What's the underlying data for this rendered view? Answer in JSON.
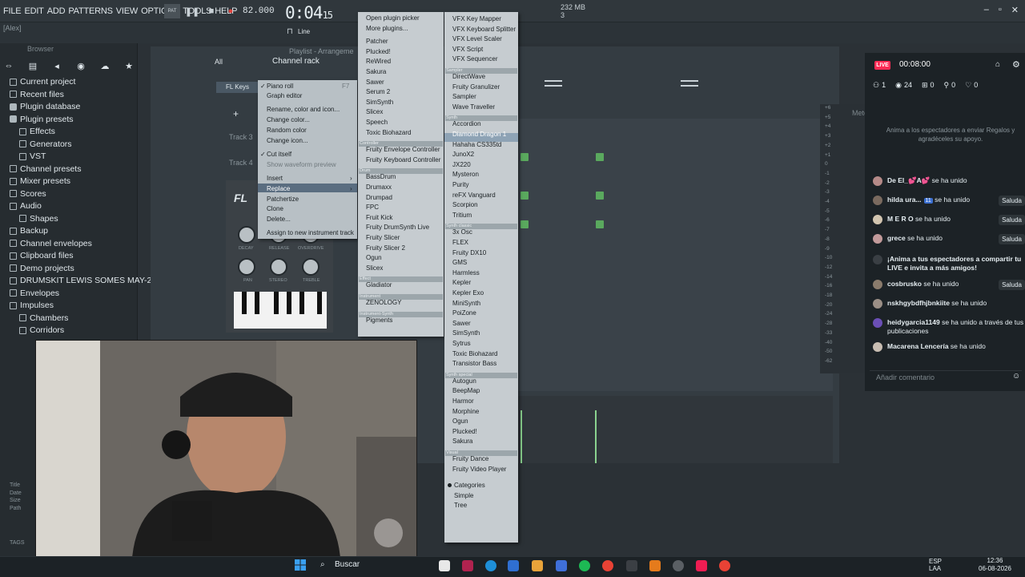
{
  "menubar": {
    "items": [
      "FILE",
      "EDIT",
      "ADD",
      "PATTERNS",
      "VIEW",
      "OPTIONS",
      "TOOLS",
      "HELP"
    ],
    "tempo": "82.000",
    "time_main": "0:04",
    "time_sub": "15",
    "memory": "232 MB",
    "memory_sub": "3"
  },
  "hint": "[Alex]",
  "toolbar": {
    "snap": "Line"
  },
  "browser": {
    "title": "Browser",
    "items": [
      {
        "label": "Current project",
        "icon": "folder"
      },
      {
        "label": "Recent files",
        "icon": "folder"
      },
      {
        "label": "Plugin database",
        "icon": "plugin"
      },
      {
        "label": "Plugin presets",
        "icon": "plugin"
      },
      {
        "label": "Effects",
        "icon": "folder"
      },
      {
        "label": "Generators",
        "icon": "folder"
      },
      {
        "label": "VST",
        "icon": "folder"
      },
      {
        "label": "Channel presets",
        "icon": "folder"
      },
      {
        "label": "Mixer presets",
        "icon": "folder"
      },
      {
        "label": "Scores",
        "icon": "folder"
      },
      {
        "label": "Audio",
        "icon": "folder"
      },
      {
        "label": "Shapes",
        "icon": "folder"
      },
      {
        "label": "Backup",
        "icon": "folder"
      },
      {
        "label": "Channel envelopes",
        "icon": "folder"
      },
      {
        "label": "Clipboard files",
        "icon": "folder"
      },
      {
        "label": "Demo projects",
        "icon": "folder"
      },
      {
        "label": "DRUMSKIT LEWIS SOMES MAY-2026",
        "icon": "folder"
      },
      {
        "label": "Envelopes",
        "icon": "folder"
      },
      {
        "label": "Impulses",
        "icon": "folder"
      },
      {
        "label": "Chambers",
        "icon": "folder"
      },
      {
        "label": "Corridors",
        "icon": "folder"
      }
    ],
    "file_info": [
      "Title",
      "Date",
      "Size",
      "Path"
    ],
    "tags": "TAGS"
  },
  "channel_rack": {
    "title": "Channel rack",
    "filter": "All",
    "playlist_tab": "Playlist - Arrangeme",
    "channel": "FL Keys",
    "tracks": [
      "Track 3",
      "Track 4"
    ],
    "knobs": [
      "DECAY",
      "RELEASE",
      "OVERDRIVE",
      "PAN",
      "STEREO",
      "TREBLE"
    ]
  },
  "context_menu": {
    "items": [
      {
        "label": "Piano roll",
        "shortcut": "F7",
        "checked": true
      },
      {
        "label": "Graph editor"
      },
      {
        "label": "Rename, color and icon..."
      },
      {
        "label": "Change color..."
      },
      {
        "label": "Random color"
      },
      {
        "label": "Change icon..."
      },
      {
        "label": "Cut itself",
        "checked": true
      },
      {
        "label": "Show waveform preview",
        "disabled": true
      },
      {
        "label": "Insert"
      },
      {
        "label": "Replace",
        "highlighted": true
      },
      {
        "label": "Patchertize"
      },
      {
        "label": "Clone"
      },
      {
        "label": "Delete..."
      },
      {
        "label": "Assign to new instrument track"
      }
    ]
  },
  "plugin_picker_1": {
    "header_items": [
      "Open plugin picker",
      "More plugins..."
    ],
    "groups": [
      {
        "category": "",
        "items": [
          "Patcher",
          "Plucked!",
          "ReWired",
          "Sakura",
          "Sawer",
          "Serum 2",
          "SimSynth",
          "Slicex",
          "Speech",
          "Toxic Biohazard"
        ]
      },
      {
        "category": "Controller",
        "items": [
          "Fruity Envelope Controller",
          "Fruity Keyboard Controller"
        ]
      },
      {
        "category": "Drum",
        "items": [
          "BassDrum",
          "Drumaxx",
          "Drumpad",
          "FPC",
          "Fruit Kick",
          "Fruity DrumSynth Live",
          "Fruity Slicer",
          "Fruity Slicer 2",
          "Ogun",
          "Slicex"
        ]
      },
      {
        "category": "Effect",
        "items": [
          "Gladiator"
        ]
      },
      {
        "category": "Instrument",
        "items": [
          "ZENOLOGY"
        ]
      },
      {
        "category": "Instrument-Synth",
        "items": [
          "Pigments"
        ]
      }
    ]
  },
  "plugin_picker_2": {
    "groups": [
      {
        "category": "",
        "items": [
          "VFX Key Mapper",
          "VFX Keyboard Splitter",
          "VFX Level Scaler",
          "VFX Script",
          "VFX Sequencer"
        ]
      },
      {
        "category": "Sampler",
        "items": [
          "DirectWave",
          "Fruity Granulizer",
          "Sampler",
          "Wave Traveller"
        ]
      },
      {
        "category": "Synth",
        "items": [
          "Accordion",
          "Diamond Dragon 1",
          "Hahaha CS335td",
          "JunoX2",
          "JX220",
          "Mysteron",
          "Purity",
          "reFX Vanguard",
          "Scorpion",
          "Tritium"
        ]
      },
      {
        "category": "Synth classic",
        "items": [
          "3x Osc",
          "FLEX",
          "Fruity DX10",
          "GMS",
          "Harmless",
          "Kepler",
          "Kepler Exo",
          "MiniSynth",
          "PoiZone",
          "Sawer",
          "SimSynth",
          "Sytrus",
          "Toxic Biohazard",
          "Transistor Bass"
        ]
      },
      {
        "category": "Synth special",
        "items": [
          "Autogun",
          "BeepMap",
          "Harmor",
          "Morphine",
          "Ogun",
          "Plucked!",
          "Sakura"
        ]
      },
      {
        "category": "Visual",
        "items": [
          "Fruity Dance",
          "Fruity Video Player"
        ]
      }
    ],
    "view_modes": [
      "Categories",
      "Simple",
      "Tree"
    ],
    "selected_view": "Categories",
    "highlighted_item": "Diamond Dragon 1"
  },
  "live_panel": {
    "badge": "LIVE",
    "timer": "00:08:00",
    "stats": [
      {
        "icon": "users-icon",
        "value": "1"
      },
      {
        "icon": "eye-icon",
        "value": "24"
      },
      {
        "icon": "gift-icon",
        "value": "0"
      },
      {
        "icon": "share-icon",
        "value": "0"
      },
      {
        "icon": "heart-icon",
        "value": "0"
      }
    ],
    "prompt": "Anima a los espectadores a enviar Regalos y agradéceles su apoyo.",
    "chat": [
      {
        "user": "De El_💕A💕",
        "text": "se ha unido",
        "saluda": false
      },
      {
        "user": "hilda ura...",
        "badge": "11",
        "text": "se ha unido",
        "saluda": true
      },
      {
        "user": "M E R O",
        "text": "se ha unido",
        "saluda": true
      },
      {
        "user": "grece",
        "text": "se ha unido",
        "saluda": true
      },
      {
        "user": "",
        "text": "¡Anima a tus espectadores a compartir tu LIVE e invita a más amigos!",
        "saluda": false
      },
      {
        "user": "cosbrusko",
        "text": "se ha unido",
        "saluda": true
      },
      {
        "user": "nskhgybdfhjbnkiite",
        "text": "se ha unido",
        "saluda": false
      },
      {
        "user": "heidygarcia1149",
        "text": "se ha unido a través de tus publicaciones",
        "saluda": false
      },
      {
        "user": "Macarena Lencería",
        "text": "se ha unido",
        "saluda": false
      }
    ],
    "saluda_label": "Saluda",
    "comment_placeholder": "Añadir comentario"
  },
  "meter": {
    "title": "Meter",
    "ticks": [
      "+6",
      "+5",
      "+4",
      "+3",
      "+2",
      "+1",
      "0",
      "-1",
      "-2",
      "-3",
      "-4",
      "-5",
      "-6",
      "-7",
      "-8",
      "-9",
      "-10",
      "-12",
      "-14",
      "-16",
      "-18",
      "-20",
      "-24",
      "-28",
      "-33",
      "-40",
      "-50",
      "-62"
    ]
  },
  "taskbar": {
    "search": "Buscar",
    "lang": "ESP",
    "lang_sub": "LAA",
    "time": "12:36",
    "date": "06-08-2026"
  },
  "colors": {
    "live_red": "#fe2c55",
    "note_green": "#5aa95e",
    "menu_highlight": "#5a6d80"
  }
}
